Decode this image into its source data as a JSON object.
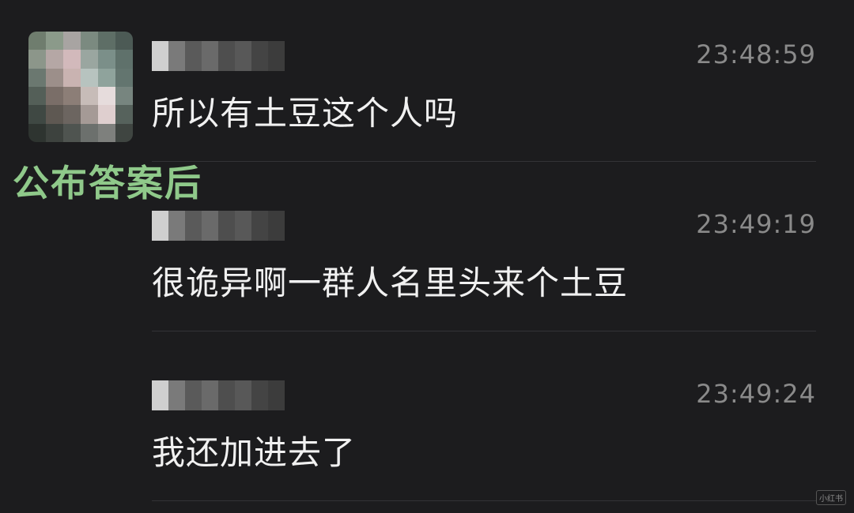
{
  "overlay_caption": "公布答案后",
  "messages": [
    {
      "time": "23:48:59",
      "text": "所以有土豆这个人吗"
    },
    {
      "time": "23:49:19",
      "text": "很诡异啊一群人名里头来个土豆"
    },
    {
      "time": "23:49:24",
      "text": "我还加进去了"
    }
  ],
  "watermark": "小红书",
  "colors": {
    "background": "#1c1c1e",
    "message_text": "#f1f1f1",
    "timestamp": "#8a8a8a",
    "caption_green": "#8fc98a"
  }
}
